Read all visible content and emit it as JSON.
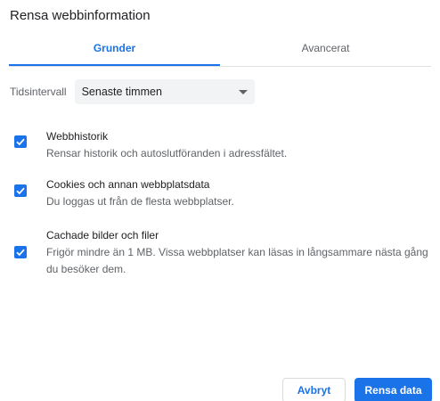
{
  "dialog": {
    "title": "Rensa webbinformation"
  },
  "tabs": [
    {
      "label": "Grunder",
      "active": true
    },
    {
      "label": "Avancerat",
      "active": false
    }
  ],
  "time_range": {
    "label": "Tidsintervall",
    "selected": "Senaste timmen"
  },
  "options": [
    {
      "title": "Webbhistorik",
      "description": "Rensar historik och autoslutföranden i adressfältet.",
      "checked": true
    },
    {
      "title": "Cookies och annan webbplatsdata",
      "description": "Du loggas ut från de flesta webbplatser.",
      "checked": true
    },
    {
      "title": "Cachade bilder och filer",
      "description": "Frigör mindre än 1 MB. Vissa webbplatser kan läsas in långsammare nästa gång du besöker dem.",
      "checked": true
    }
  ],
  "buttons": {
    "cancel": "Avbryt",
    "confirm": "Rensa data"
  },
  "colors": {
    "accent": "#1a73e8",
    "text_primary": "#202124",
    "text_secondary": "#5f6368",
    "select_bg": "#f1f3f4"
  },
  "icons": {
    "checkbox": "check-icon",
    "dropdown": "caret-down-icon"
  }
}
